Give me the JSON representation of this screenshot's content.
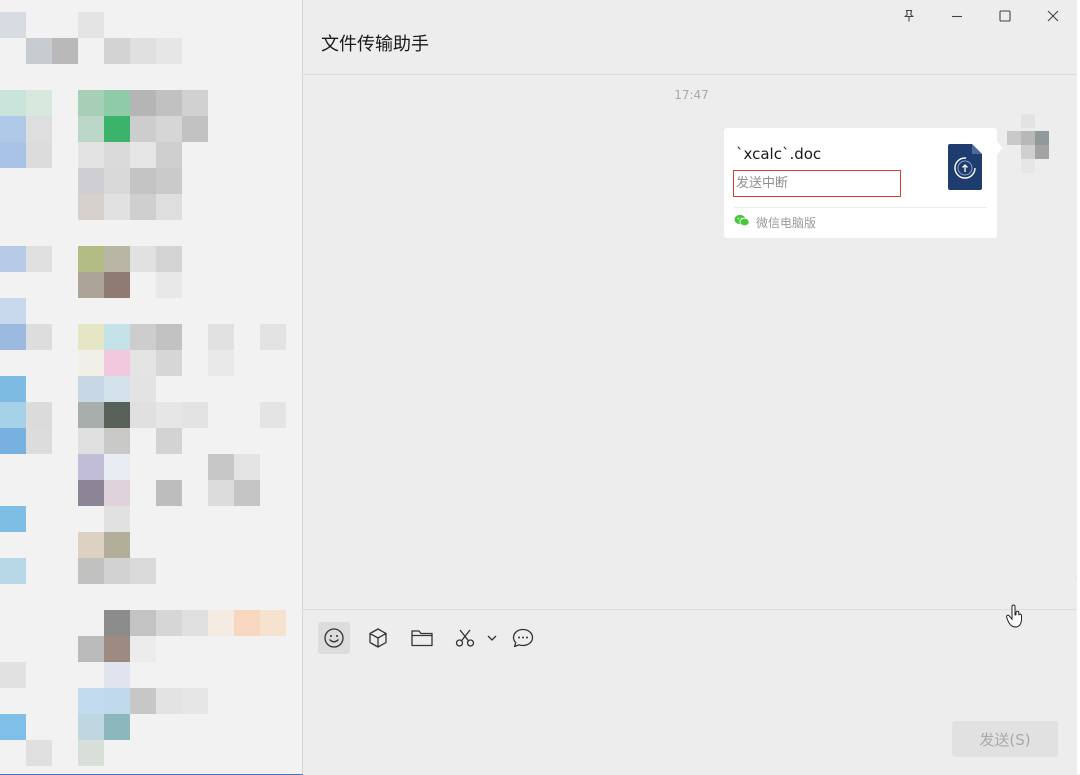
{
  "window": {
    "title": "文件传输助手",
    "controls": [
      "pin-icon",
      "minimize-icon",
      "maximize-icon",
      "close-icon"
    ]
  },
  "conversation": {
    "timestamp": "17:47",
    "messages": [
      {
        "type": "file",
        "file_name": "`xcalc`.doc",
        "status": "发送中断",
        "source": "微信电脑版",
        "icon": "doc-upload-icon"
      }
    ]
  },
  "toolbar": {
    "items": [
      "emoji-icon",
      "cube-icon",
      "folder-icon",
      "scissors-icon",
      "chevron-down-icon",
      "chat-history-icon"
    ]
  },
  "input": {
    "send_label": "发送(S)"
  },
  "colors": {
    "chat_background": "#ededed",
    "card_background": "#ffffff",
    "status_border": "#d93b3b",
    "file_icon": "#1f3c6e",
    "wechat_green": "#46c83a"
  }
}
